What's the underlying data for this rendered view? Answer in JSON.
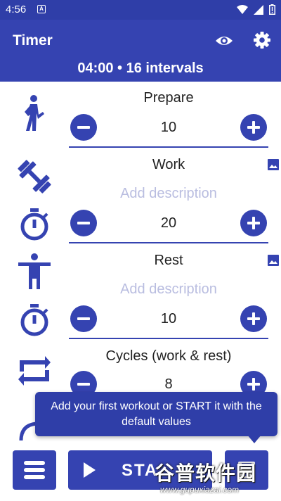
{
  "status_bar": {
    "time": "4:56",
    "notification_icon": "A"
  },
  "app_bar": {
    "title": "Timer",
    "summary": "04:00 • 16 intervals",
    "eye_icon": "eye-icon",
    "settings_icon": "gear-icon"
  },
  "sections": [
    {
      "title": "Prepare",
      "value": "10",
      "icon": "walking-person-icon"
    },
    {
      "title": "Work",
      "description_placeholder": "Add description",
      "value": "20",
      "icon": "dumbbell-icon",
      "timer_icon": "stopwatch-icon"
    },
    {
      "title": "Rest",
      "description_placeholder": "Add description",
      "value": "10",
      "icon": "standing-person-icon",
      "timer_icon": "stopwatch-icon"
    },
    {
      "title": "Cycles (work & rest)",
      "value": "8",
      "icon": "repeat-icon"
    }
  ],
  "tooltip": {
    "text": "Add your first workout or START it with the default values"
  },
  "bottom_bar": {
    "start_label": "STA",
    "menu_icon": "list-icon",
    "save_icon": "save-icon"
  },
  "watermark": {
    "text": "谷普软件园",
    "url": "www.gupuxiazai.com"
  },
  "colors": {
    "primary": "#3543b1",
    "status_bar": "#2f3ea8",
    "placeholder": "#b9bde0"
  }
}
